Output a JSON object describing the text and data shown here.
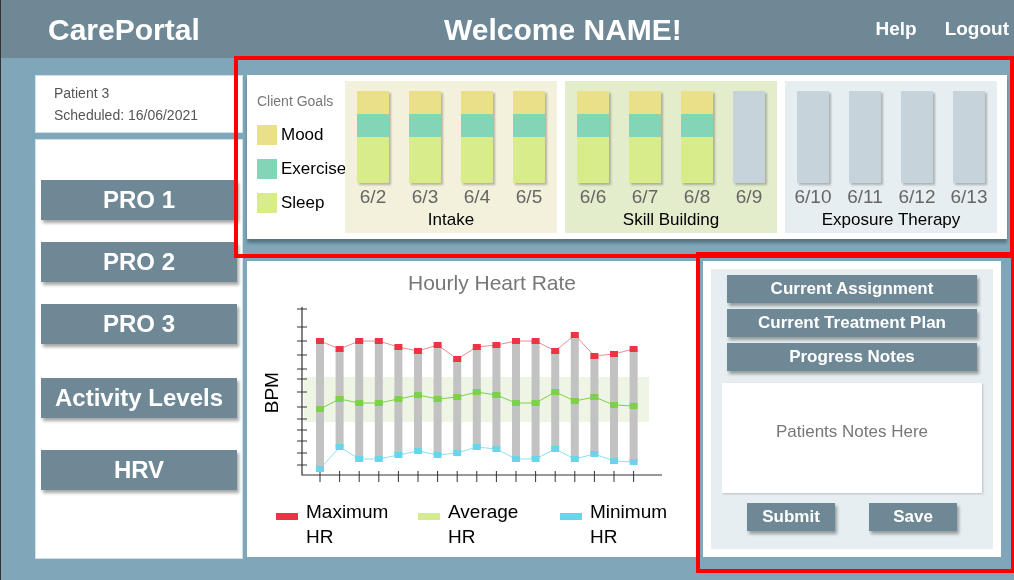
{
  "header": {
    "logo": "CarePortal",
    "greeting": "Welcome NAME!",
    "links": [
      "Help",
      "Logout"
    ]
  },
  "patient": {
    "name": "Patient 3",
    "scheduled": "Scheduled: 16/06/2021"
  },
  "nav_buttons": [
    "PRO 1",
    "PRO 2",
    "PRO 3",
    "Activity Levels",
    "HRV"
  ],
  "goals": {
    "title": "Client Goals",
    "legend": [
      {
        "label": "Mood",
        "color": "#ebe08a"
      },
      {
        "label": "Exercise",
        "color": "#84d4b8"
      },
      {
        "label": "Sleep",
        "color": "#d8ec8c"
      }
    ],
    "phases": [
      {
        "label": "Intake",
        "color": "#f3f0dc",
        "days": [
          {
            "date": "6/2",
            "done": true
          },
          {
            "date": "6/3",
            "done": true
          },
          {
            "date": "6/4",
            "done": true
          },
          {
            "date": "6/5",
            "done": true
          }
        ]
      },
      {
        "label": "Skill Building",
        "color": "#e3edcc",
        "days": [
          {
            "date": "6/6",
            "done": true
          },
          {
            "date": "6/7",
            "done": true
          },
          {
            "date": "6/8",
            "done": true
          },
          {
            "date": "6/9",
            "done": false
          }
        ]
      },
      {
        "label": "Exposure Therapy",
        "color": "#e6eef2",
        "days": [
          {
            "date": "6/10",
            "done": false
          },
          {
            "date": "6/11",
            "done": false
          },
          {
            "date": "6/12",
            "done": false
          },
          {
            "date": "6/13",
            "done": false
          }
        ]
      }
    ]
  },
  "heart_rate": {
    "title": "Hourly Heart Rate",
    "ylabel": "BPM",
    "legend": [
      {
        "label": "Maximum HR",
        "color": "#ee3344"
      },
      {
        "label": "Average HR",
        "color": "#d4ec8c"
      },
      {
        "label": "Minimum HR",
        "color": "#6ad4ea"
      }
    ]
  },
  "side_panel": {
    "tabs": [
      "Current Assignment",
      "Current Treatment Plan",
      "Progress Notes"
    ],
    "notes_placeholder": "Patients Notes Here",
    "actions": [
      "Submit",
      "Save"
    ]
  }
}
